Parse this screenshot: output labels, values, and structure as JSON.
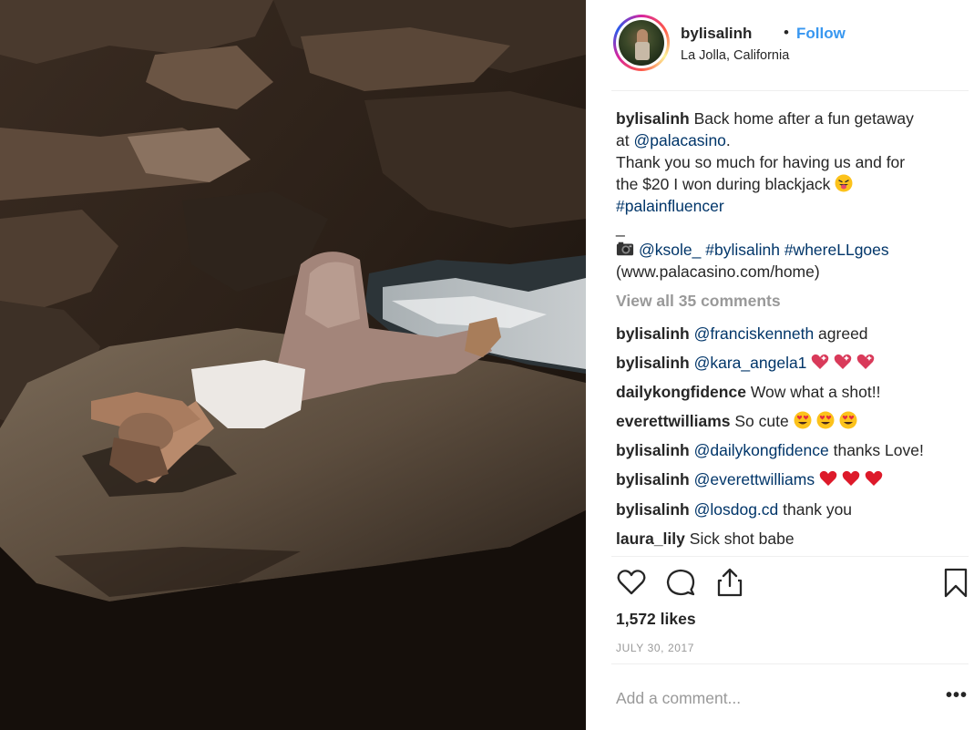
{
  "post": {
    "username": "bylisalinh",
    "follow_label": "Follow",
    "dot": "•",
    "location": "La Jolla, California"
  },
  "caption": {
    "username": "bylisalinh",
    "line1": "Back home after a fun getaway",
    "line2_prefix": "at ",
    "line2_mention": "@palacasino",
    "line2_suffix": ".",
    "line3": "Thank you so much for having us and for",
    "line4": "the $20 I won during blackjack",
    "hashtag1": "#palainfluencer",
    "line6": "_",
    "camera_icon": "camera-icon",
    "mention2": "@ksole_",
    "hashtag2": "#bylisalinh",
    "hashtag3": "#whereLLgoes",
    "url": "(www.palacasino.com/home)"
  },
  "view_all_label": "View all 35 comments",
  "comments": [
    {
      "user": "bylisalinh",
      "mention": "@franciskenneth",
      "text": " agreed"
    },
    {
      "user": "bylisalinh",
      "mention": "@kara_angela1",
      "text": ""
    },
    {
      "user": "dailykongfidence",
      "mention": "",
      "text": "Wow what a shot!!"
    },
    {
      "user": "everettwilliams",
      "mention": "",
      "text": "So cute"
    },
    {
      "user": "bylisalinh",
      "mention": "@dailykongfidence",
      "text": " thanks Love!"
    },
    {
      "user": "bylisalinh",
      "mention": "@everettwilliams",
      "text": ""
    },
    {
      "user": "bylisalinh",
      "mention": "@losdog.cd",
      "text": " thank you"
    },
    {
      "user": "laura_lily",
      "mention": "",
      "text": "Sick shot babe"
    }
  ],
  "likes_label": "1,572 likes",
  "date_label": "JULY 30, 2017",
  "add_comment_placeholder": "Add a comment...",
  "more_label": "•••",
  "colors": {
    "link": "#003569",
    "follow": "#3897f0",
    "muted": "#999999",
    "text": "#262626"
  }
}
